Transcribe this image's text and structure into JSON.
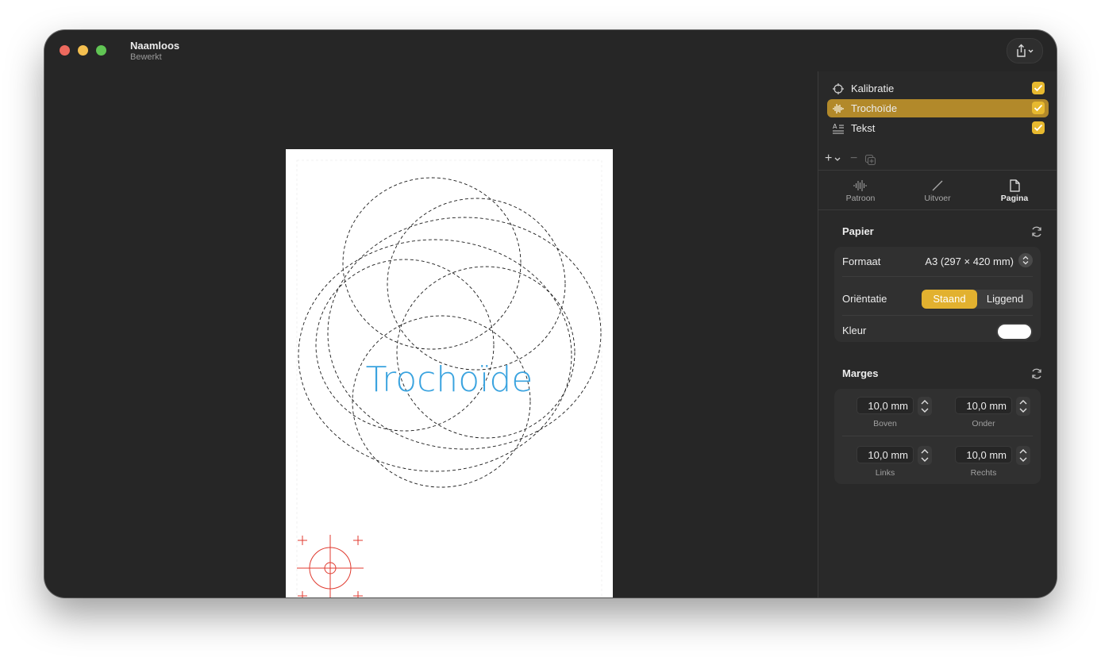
{
  "window": {
    "title": "Naamloos",
    "subtitle": "Bewerkt"
  },
  "canvas": {
    "paper_text": "Trochoïde",
    "text_color": "#3aa3df",
    "mark_color": "#e03a2f"
  },
  "layers": [
    {
      "name": "Kalibratie",
      "icon": "crosshair-icon",
      "checked": true,
      "selected": false
    },
    {
      "name": "Trochoïde",
      "icon": "waveform-icon",
      "checked": true,
      "selected": true
    },
    {
      "name": "Tekst",
      "icon": "text-format-icon",
      "checked": true,
      "selected": false
    }
  ],
  "layer_tools": {
    "add": "+",
    "remove": "−"
  },
  "tabs": [
    {
      "label": "Patroon",
      "icon": "waveform-icon",
      "active": false
    },
    {
      "label": "Uitvoer",
      "icon": "pen-line-icon",
      "active": false
    },
    {
      "label": "Pagina",
      "icon": "page-icon",
      "active": true
    }
  ],
  "papier": {
    "title": "Papier",
    "format_label": "Formaat",
    "format_value": "A3 (297 × 420 mm)",
    "orientation_label": "Oriëntatie",
    "orientation_options": [
      "Staand",
      "Liggend"
    ],
    "orientation_selected": "Staand",
    "color_label": "Kleur",
    "color_value": "#ffffff"
  },
  "marges": {
    "title": "Marges",
    "top": {
      "value": "10,0 mm",
      "label": "Boven"
    },
    "bottom": {
      "value": "10,0 mm",
      "label": "Onder"
    },
    "left": {
      "value": "10,0 mm",
      "label": "Links"
    },
    "right": {
      "value": "10,0 mm",
      "label": "Rechts"
    }
  },
  "colors": {
    "accent": "#e2b12f",
    "selected_layer": "#b2892a",
    "window_bg": "#262626",
    "sidebar_bg": "#292929"
  }
}
